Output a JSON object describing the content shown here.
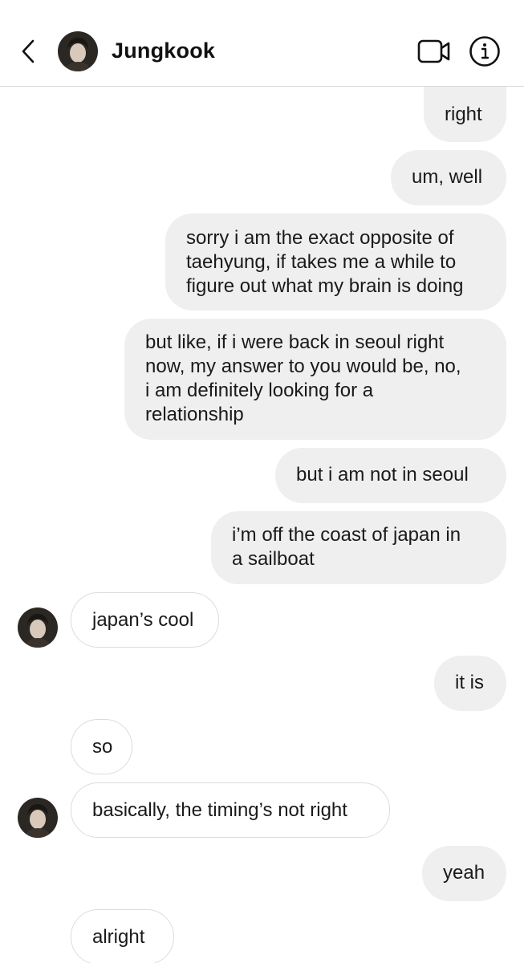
{
  "header": {
    "contact_name": "Jungkook",
    "back_icon": "chevron-left-icon",
    "video_icon": "video-camera-icon",
    "info_icon": "info-icon"
  },
  "colors": {
    "sent_bubble": "#efefef",
    "received_bubble_border": "#dcdcdc",
    "text": "#1a1a1a",
    "header_divider": "#d7d7d7"
  },
  "messages": [
    {
      "sender": "me",
      "text": "right"
    },
    {
      "sender": "me",
      "text": "um, well"
    },
    {
      "sender": "me",
      "lines": [
        "sorry i am the exact opposite of",
        "taehyung, if takes me a while to",
        "figure out what my brain is doing"
      ]
    },
    {
      "sender": "me",
      "lines": [
        "but like, if i were back in seoul right",
        "now, my answer to you would be, no,",
        "i am definitely looking for a",
        "relationship"
      ]
    },
    {
      "sender": "me",
      "text": "but i am not in seoul"
    },
    {
      "sender": "me",
      "lines": [
        "i’m off the coast of japan in",
        "a sailboat"
      ]
    },
    {
      "sender": "them",
      "text": "japan’s cool"
    },
    {
      "sender": "me",
      "text": "it is"
    },
    {
      "sender": "them",
      "text": "so"
    },
    {
      "sender": "them",
      "text": "basically, the timing’s not right"
    },
    {
      "sender": "me",
      "text": "yeah"
    },
    {
      "sender": "them",
      "text": "alright"
    }
  ]
}
